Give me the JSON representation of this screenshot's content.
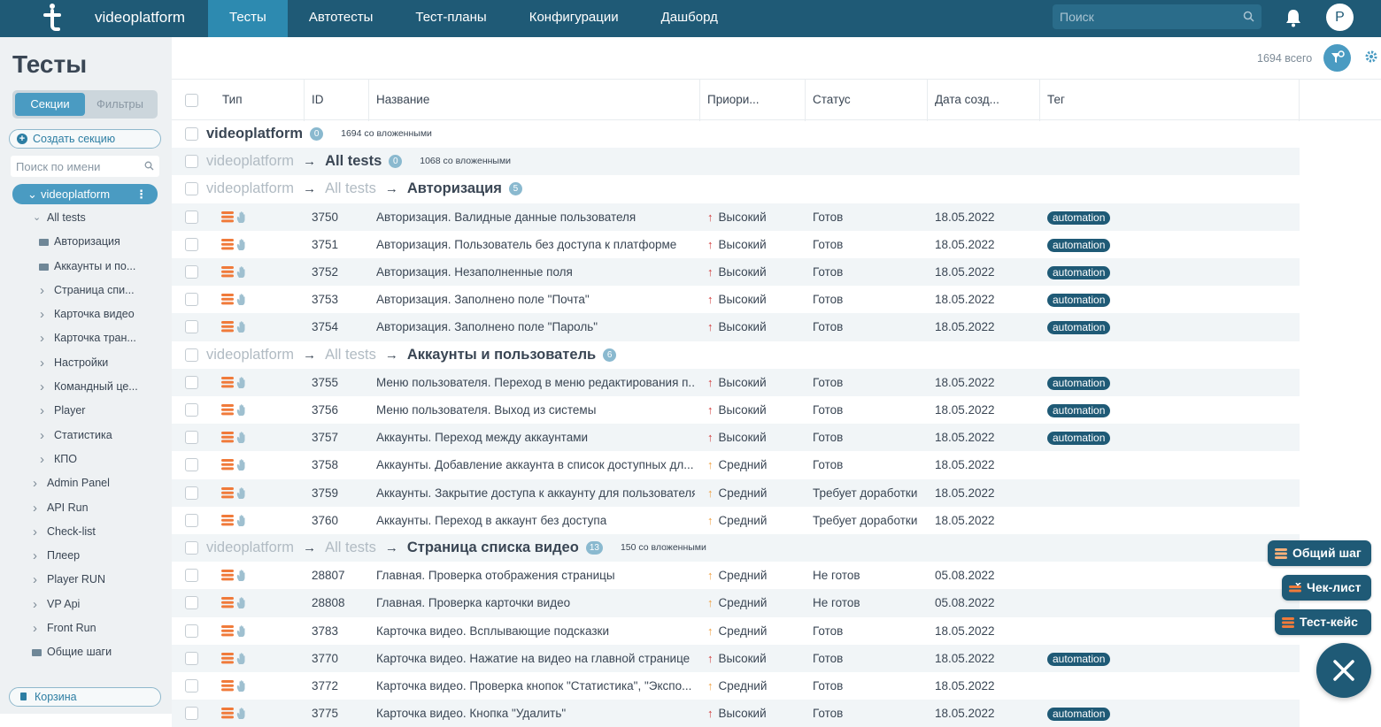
{
  "topnav": {
    "app_name": "videoplatform",
    "tabs": [
      {
        "label": "Тесты",
        "active": true
      },
      {
        "label": "Автотесты",
        "active": false
      },
      {
        "label": "Тест-планы",
        "active": false
      },
      {
        "label": "Конфигурации",
        "active": false
      },
      {
        "label": "Дашборд",
        "active": false
      }
    ],
    "search_placeholder": "Поиск",
    "avatar_letter": "P"
  },
  "sidebar": {
    "page_title": "Тесты",
    "segments": [
      {
        "label": "Секции",
        "active": true
      },
      {
        "label": "Фильтры",
        "active": false
      }
    ],
    "create_section_label": "Создать секцию",
    "search_placeholder": "Поиск по имени",
    "root_label": "videoplatform",
    "tree": [
      {
        "label": "All tests",
        "level": 1,
        "kind": "chevron-down"
      },
      {
        "label": "Авторизация",
        "level": 2,
        "kind": "folder"
      },
      {
        "label": "Аккаунты и по...",
        "level": 2,
        "kind": "folder"
      },
      {
        "label": "Страница спи...",
        "level": 2,
        "kind": "chevron-right"
      },
      {
        "label": "Карточка видео",
        "level": 2,
        "kind": "chevron-right"
      },
      {
        "label": "Карточка тран...",
        "level": 2,
        "kind": "chevron-right"
      },
      {
        "label": "Настройки",
        "level": 2,
        "kind": "chevron-right"
      },
      {
        "label": "Командный це...",
        "level": 2,
        "kind": "chevron-right"
      },
      {
        "label": "Player",
        "level": 2,
        "kind": "chevron-right"
      },
      {
        "label": "Статистика",
        "level": 2,
        "kind": "chevron-right"
      },
      {
        "label": "КПО",
        "level": 2,
        "kind": "chevron-right"
      },
      {
        "label": "Admin Panel",
        "level": 1,
        "kind": "chevron-right"
      },
      {
        "label": "API Run",
        "level": 1,
        "kind": "chevron-right"
      },
      {
        "label": "Check-list",
        "level": 1,
        "kind": "chevron-right"
      },
      {
        "label": "Плеер",
        "level": 1,
        "kind": "chevron-right"
      },
      {
        "label": "Player RUN",
        "level": 1,
        "kind": "chevron-right"
      },
      {
        "label": "VP Api",
        "level": 1,
        "kind": "chevron-right"
      },
      {
        "label": "Front Run",
        "level": 1,
        "kind": "chevron-right"
      },
      {
        "label": "Общие шаги",
        "level": 1,
        "kind": "folder"
      }
    ],
    "trash_label": "Корзина"
  },
  "main": {
    "total": "1694 всего",
    "columns": [
      "Тип",
      "ID",
      "Название",
      "Приори...",
      "Статус",
      "Дата созд...",
      "Тег"
    ],
    "rows": [
      {
        "section": true,
        "alt": false,
        "crumbs": [
          {
            "text": "videoplatform",
            "bold": true
          }
        ],
        "count": "0",
        "nested": "1694 со вложенными"
      },
      {
        "section": true,
        "alt": true,
        "crumbs": [
          {
            "text": "videoplatform",
            "bold": false
          },
          {
            "text": "All tests",
            "bold": true
          }
        ],
        "count": "0",
        "nested": "1068 со вложенными"
      },
      {
        "section": true,
        "alt": false,
        "crumbs": [
          {
            "text": "videoplatform",
            "bold": false
          },
          {
            "text": "All tests",
            "bold": false
          },
          {
            "text": "Авторизация",
            "bold": true
          }
        ],
        "count": "5",
        "nested": ""
      },
      {
        "id": "3750",
        "name": "Авторизация. Валидные данные пользователя",
        "priority": "Высокий",
        "prio_level": "high",
        "status": "Готов",
        "date": "18.05.2022",
        "tag": "automation",
        "alt": true
      },
      {
        "id": "3751",
        "name": "Авторизация. Пользователь без доступа к платформе",
        "priority": "Высокий",
        "prio_level": "high",
        "status": "Готов",
        "date": "18.05.2022",
        "tag": "automation",
        "alt": false
      },
      {
        "id": "3752",
        "name": "Авторизация. Незаполненные поля",
        "priority": "Высокий",
        "prio_level": "high",
        "status": "Готов",
        "date": "18.05.2022",
        "tag": "automation",
        "alt": true
      },
      {
        "id": "3753",
        "name": "Авторизация. Заполнено поле \"Почта\"",
        "priority": "Высокий",
        "prio_level": "high",
        "status": "Готов",
        "date": "18.05.2022",
        "tag": "automation",
        "alt": false
      },
      {
        "id": "3754",
        "name": "Авторизация. Заполнено поле \"Пароль\"",
        "priority": "Высокий",
        "prio_level": "high",
        "status": "Готов",
        "date": "18.05.2022",
        "tag": "automation",
        "alt": true
      },
      {
        "section": true,
        "alt": false,
        "crumbs": [
          {
            "text": "videoplatform",
            "bold": false
          },
          {
            "text": "All tests",
            "bold": false
          },
          {
            "text": "Аккаунты и пользователь",
            "bold": true
          }
        ],
        "count": "6",
        "nested": ""
      },
      {
        "id": "3755",
        "name": "Меню пользователя. Переход в меню редактирования п...",
        "priority": "Высокий",
        "prio_level": "high",
        "status": "Готов",
        "date": "18.05.2022",
        "tag": "automation",
        "alt": true
      },
      {
        "id": "3756",
        "name": "Меню пользователя. Выход из системы",
        "priority": "Высокий",
        "prio_level": "high",
        "status": "Готов",
        "date": "18.05.2022",
        "tag": "automation",
        "alt": false
      },
      {
        "id": "3757",
        "name": "Аккаунты. Переход между аккаунтами",
        "priority": "Высокий",
        "prio_level": "high",
        "status": "Готов",
        "date": "18.05.2022",
        "tag": "automation",
        "alt": true
      },
      {
        "id": "3758",
        "name": "Аккаунты. Добавление аккаунта в список доступных дл...",
        "priority": "Средний",
        "prio_level": "medium",
        "status": "Готов",
        "date": "18.05.2022",
        "tag": "",
        "alt": false
      },
      {
        "id": "3759",
        "name": "Аккаунты. Закрытие доступа к аккаунту для пользователя",
        "priority": "Средний",
        "prio_level": "medium",
        "status": "Требует доработки",
        "date": "18.05.2022",
        "tag": "",
        "alt": true
      },
      {
        "id": "3760",
        "name": "Аккаунты. Переход в аккаунт без доступа",
        "priority": "Средний",
        "prio_level": "medium",
        "status": "Требует доработки",
        "date": "18.05.2022",
        "tag": "",
        "alt": false
      },
      {
        "section": true,
        "alt": true,
        "crumbs": [
          {
            "text": "videoplatform",
            "bold": false
          },
          {
            "text": "All tests",
            "bold": false
          },
          {
            "text": "Страница списка видео",
            "bold": true
          }
        ],
        "count": "13",
        "nested": "150 со вложенными"
      },
      {
        "id": "28807",
        "name": "Главная. Проверка отображения страницы",
        "priority": "Средний",
        "prio_level": "medium",
        "status": "Не готов",
        "date": "05.08.2022",
        "tag": "",
        "alt": false
      },
      {
        "id": "28808",
        "name": "Главная. Проверка карточки видео",
        "priority": "Средний",
        "prio_level": "medium",
        "status": "Не готов",
        "date": "05.08.2022",
        "tag": "",
        "alt": true
      },
      {
        "id": "3783",
        "name": "Карточка видео. Всплывающие подсказки",
        "priority": "Средний",
        "prio_level": "medium",
        "status": "Готов",
        "date": "18.05.2022",
        "tag": "",
        "alt": false
      },
      {
        "id": "3770",
        "name": "Карточка видео. Нажатие на видео на главной странице",
        "priority": "Высокий",
        "prio_level": "high",
        "status": "Готов",
        "date": "18.05.2022",
        "tag": "automation",
        "alt": true
      },
      {
        "id": "3772",
        "name": "Карточка видео. Проверка кнопок \"Статистика\", \"Экспо...",
        "priority": "Средний",
        "prio_level": "medium",
        "status": "Готов",
        "date": "18.05.2022",
        "tag": "",
        "alt": false
      },
      {
        "id": "3775",
        "name": "Карточка видео. Кнопка \"Удалить\"",
        "priority": "Высокий",
        "prio_level": "high",
        "status": "Готов",
        "date": "18.05.2022",
        "tag": "automation",
        "alt": true
      }
    ]
  },
  "fab_menu": {
    "items": [
      {
        "label": "Общий шаг",
        "icon": "shared-step-icon"
      },
      {
        "label": "Чек-лист",
        "icon": "checklist-icon"
      },
      {
        "label": "Тест-кейс",
        "icon": "test-case-icon"
      }
    ]
  },
  "colors": {
    "topbar": "#1f5a76",
    "active_tab": "#2d8ab0",
    "accent": "#4a9bc2",
    "priority_high": "#d23c3c",
    "priority_medium": "#f0a040",
    "type_icon": "#f07a3a"
  }
}
